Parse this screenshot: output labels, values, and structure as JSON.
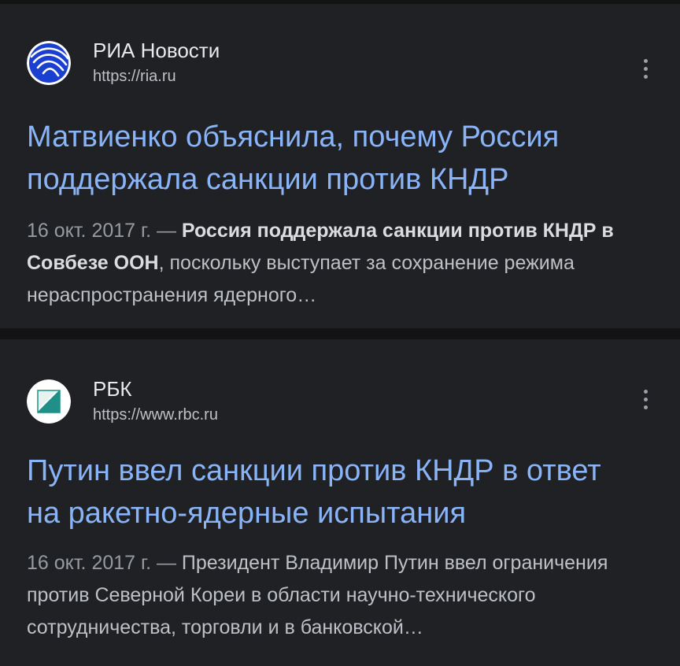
{
  "results": [
    {
      "source_name": "РИА Новости",
      "url": "https://ria.ru",
      "icon": "ria-logo-icon",
      "title": "Матвиенко объяснила, почему Россия поддержала санкции против КНДР",
      "date": "16 окт. 2017 г. — ",
      "snippet_bold": "Россия поддержала санкции против КНДР в Совбезе ООН",
      "snippet_rest": ", поскольку выступает за сохранение режима нераспространения ядерного…"
    },
    {
      "source_name": "РБК",
      "url": "https://www.rbc.ru",
      "icon": "rbc-logo-icon",
      "title": "Путин ввел санкции против КНДР в ответ на ракетно-ядерные испытания",
      "date": "16 окт. 2017 г. — ",
      "snippet_bold": "",
      "snippet_rest": "Президент Владимир Путин ввел ограничения против Северной Кореи в области научно-технического сотрудничества, торговли и в банковской…"
    }
  ],
  "colors": {
    "background": "#131313",
    "card": "#202124",
    "link": "#8ab4f8",
    "text": "#bdc1c6",
    "ria_blue": "#1a3cc8",
    "rbc_teal": "#1f8f87"
  }
}
